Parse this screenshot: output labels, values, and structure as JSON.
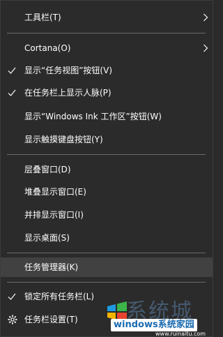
{
  "menu": {
    "items": [
      {
        "label": "工具栏(T)",
        "checked": false,
        "submenu": true
      },
      {
        "label": "Cortana(O)",
        "checked": false,
        "submenu": true
      },
      {
        "label": "显示“任务视图”按钮(V)",
        "checked": true,
        "submenu": false
      },
      {
        "label": "在任务栏上显示人脉(P)",
        "checked": true,
        "submenu": false
      },
      {
        "label": "显示“Windows Ink 工作区”按钮(W)",
        "checked": false,
        "submenu": false
      },
      {
        "label": "显示触摸键盘按钮(Y)",
        "checked": false,
        "submenu": false
      },
      {
        "label": "层叠窗口(D)",
        "checked": false,
        "submenu": false
      },
      {
        "label": "堆叠显示窗口(E)",
        "checked": false,
        "submenu": false
      },
      {
        "label": "并排显示窗口(I)",
        "checked": false,
        "submenu": false
      },
      {
        "label": "显示桌面(S)",
        "checked": false,
        "submenu": false
      },
      {
        "label": "任务管理器(K)",
        "checked": false,
        "submenu": false,
        "highlighted": true
      },
      {
        "label": "锁定所有任务栏(L)",
        "checked": true,
        "submenu": false
      },
      {
        "label": "任务栏设置(T)",
        "checked": false,
        "submenu": false,
        "icon": "gear-icon"
      }
    ]
  },
  "watermark": {
    "text": "windows系统家园",
    "background_text": "系统城",
    "url": "www.ruinaitu.com"
  },
  "colors": {
    "background": "#2b2b2b",
    "highlight": "#414141",
    "separator": "#6a6a6a",
    "text": "#ffffff"
  }
}
